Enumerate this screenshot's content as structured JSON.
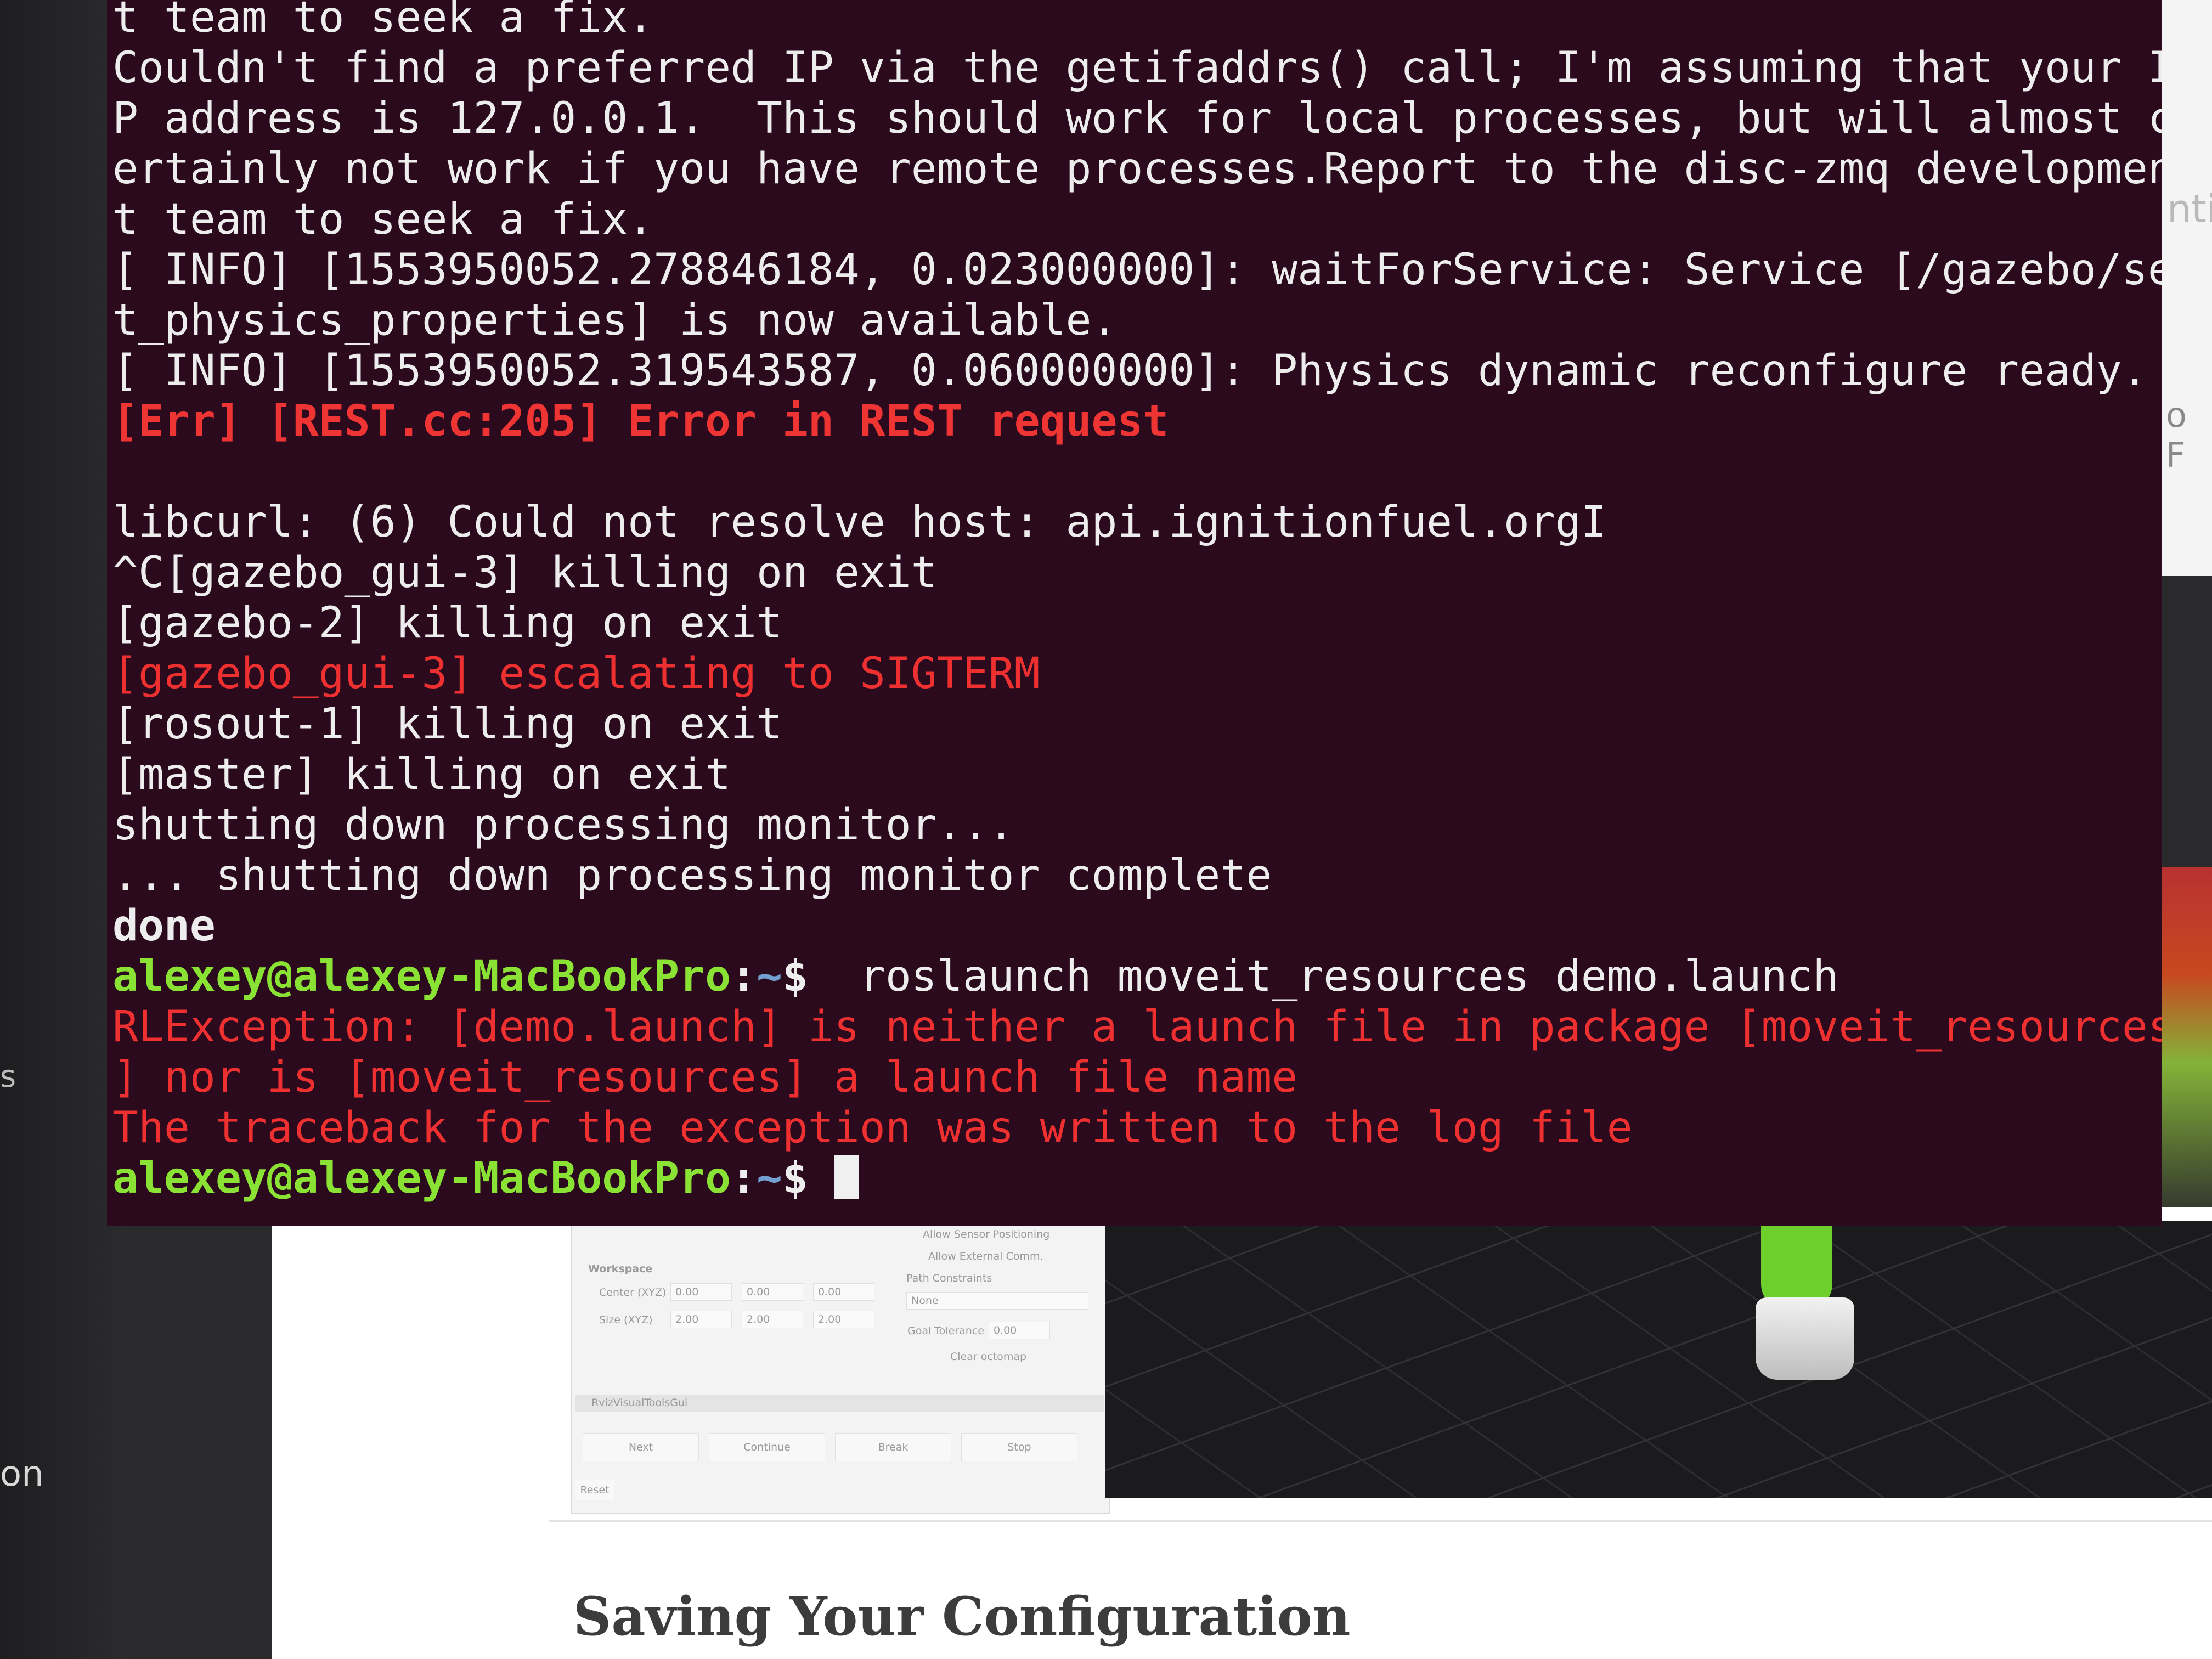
{
  "desktop": {
    "left_label": "on",
    "left_glyph": "s",
    "right_text_1": "nti",
    "right_text_2": "o F"
  },
  "terminal": {
    "lines": {
      "l1": "t team to seek a fix.",
      "l2": "Couldn't find a preferred IP via the getifaddrs() call; I'm assuming that your I",
      "l3": "P address is 127.0.0.1.  This should work for local processes, but will almost c",
      "l4": "ertainly not work if you have remote processes.Report to the disc-zmq developmen",
      "l5": "t team to seek a fix.",
      "l6": "[ INFO] [1553950052.278846184, 0.023000000]: waitForService: Service [/gazebo/se",
      "l7": "t_physics_properties] is now available.",
      "l8": "[ INFO] [1553950052.319543587, 0.060000000]: Physics dynamic reconfigure ready.",
      "l9": "[Err] [REST.cc:205] Error in REST request",
      "l11": "libcurl: (6) Could not resolve host: api.ignitionfuel.org",
      "l12": "^C[gazebo_gui-3] killing on exit",
      "l13": "[gazebo-2] killing on exit",
      "l14": "[gazebo_gui-3] escalating to SIGTERM",
      "l15": "[rosout-1] killing on exit",
      "l16": "[master] killing on exit",
      "l17": "shutting down processing monitor...",
      "l18": "... shutting down processing monitor complete",
      "l19": "done",
      "l24_user": "alexey@alexey-MacBookPro",
      "l24_sep": ":",
      "l24_path": "~",
      "l24_dollar": "$"
    },
    "prompt1": {
      "user": "alexey@alexey-MacBookPro",
      "sep": ":",
      "path": "~",
      "dollar": "$",
      "command": "  roslaunch moveit_resources demo.launch"
    },
    "error_lines": {
      "e1": "RLException: [demo.launch] is neither a launch file in package [moveit_resources",
      "e2": "] nor is [moveit_resources] a launch file name",
      "e3": "The traceback for the exception was written to the log file"
    },
    "text_cursor_glyph": "I"
  },
  "rviz_panel": {
    "allow_sensor": "Allow Sensor Positioning",
    "allow_external": "Allow External Comm.",
    "workspace_label": "Workspace",
    "path_constraints": "Path Constraints",
    "center_label": "Center (XYZ)",
    "size_label": "Size (XYZ)",
    "center_values": [
      "0.00",
      "0.00",
      "0.00"
    ],
    "size_values": [
      "2.00",
      "2.00",
      "2.00"
    ],
    "constraint_value": "None",
    "goal_tolerance_label": "Goal Tolerance",
    "goal_tolerance_value": "0.00",
    "clear_octomap": "Clear octomap",
    "tools_gui": "RvizVisualToolsGui",
    "buttons": [
      "Next",
      "Continue",
      "Break",
      "Stop"
    ],
    "reset": "Reset"
  },
  "doc": {
    "heading": "Saving Your Configuration"
  },
  "colors": {
    "terminal_bg": "#2c0a1e",
    "terminal_fg": "#ededed",
    "error_red": "#ef3434",
    "prompt_green": "#8ae234",
    "prompt_blue": "#729fcf"
  }
}
